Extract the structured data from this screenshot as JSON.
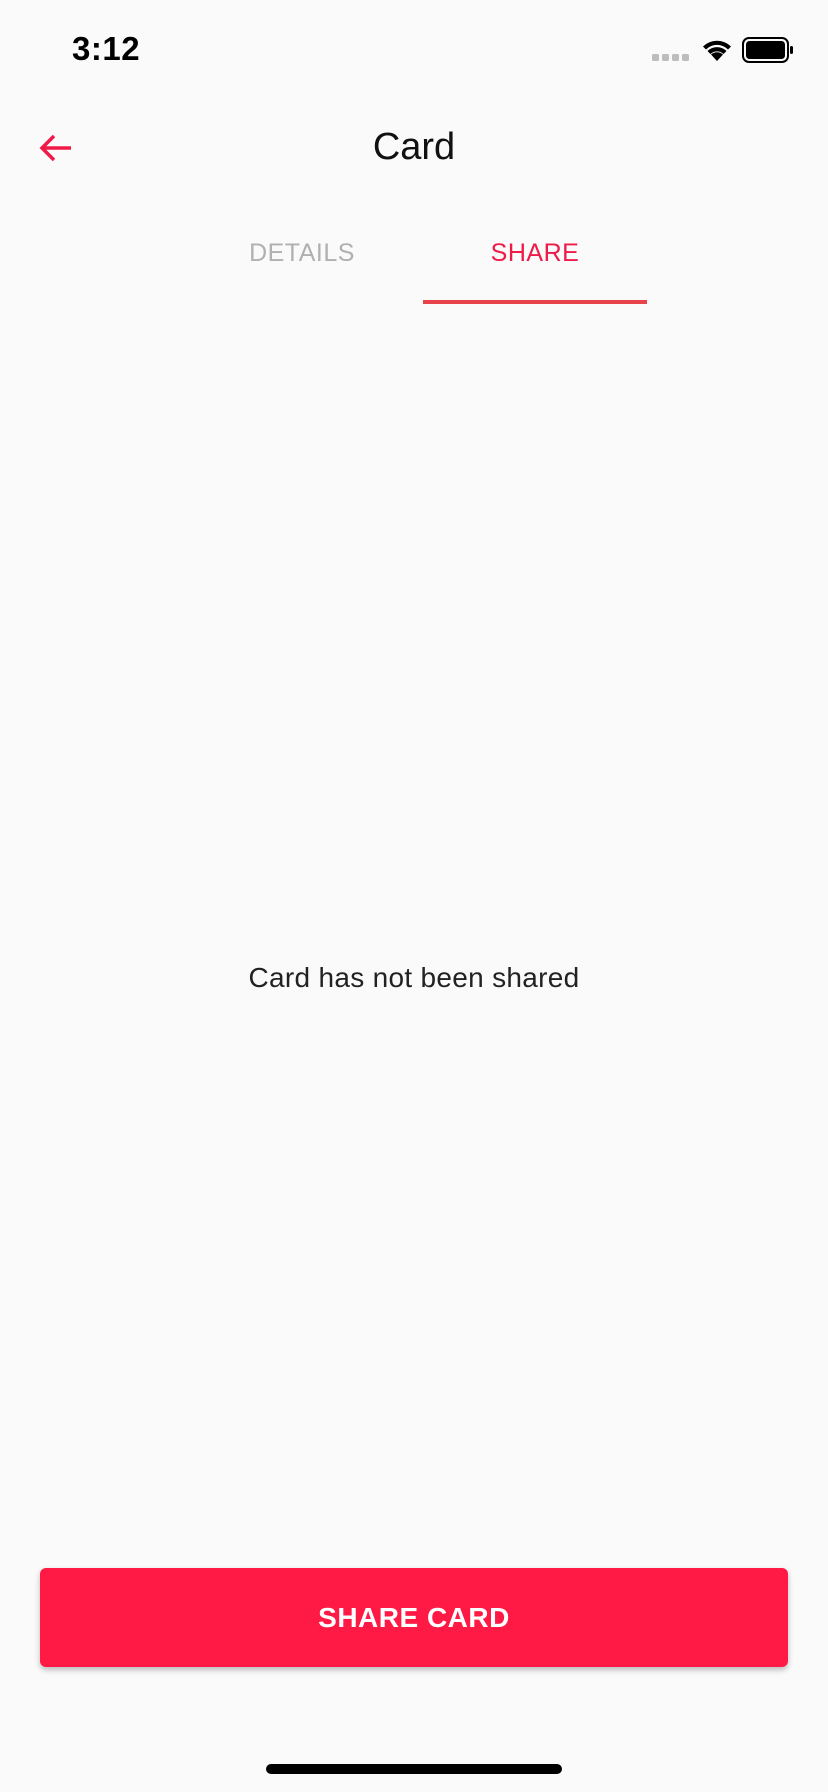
{
  "status_bar": {
    "time": "3:12"
  },
  "header": {
    "title": "Card",
    "back_icon": "arrow-left-icon"
  },
  "tabs": [
    {
      "label": "DETAILS",
      "active": false
    },
    {
      "label": "SHARE",
      "active": true
    }
  ],
  "share_tab": {
    "empty_message": "Card has not been shared",
    "share_button_label": "SHARE CARD"
  },
  "colors": {
    "accent": "#ff1945",
    "tab_active": "#ef1a48",
    "tab_indicator": "#e8434b",
    "tab_inactive": "#b0b0b0",
    "background": "#fafafa"
  }
}
